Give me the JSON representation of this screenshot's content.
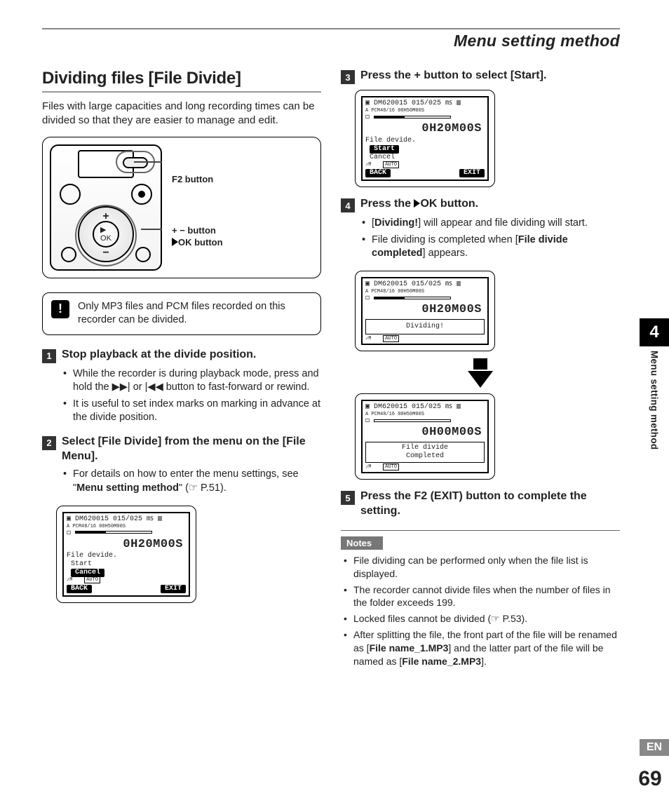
{
  "header": {
    "title": "Menu setting method"
  },
  "section_title": "Dividing files [File Divide]",
  "intro": "Files with large capacities and long recording times can be divided so that they are easier to manage and edit.",
  "diagram": {
    "label_f2": "F2 button",
    "label_plusminus": "+ − button",
    "label_ok": "OK button"
  },
  "warning": "Only MP3 files and PCM files recorded on this recorder can be divided.",
  "steps": {
    "s1": {
      "num": "1",
      "title": "Stop playback at the divide position.",
      "bullets": [
        "While the recorder is during playback mode, press and hold the  ▶▶|  or  |◀◀  button to fast-forward or rewind.",
        "It is useful to set index marks on marking in advance at the divide position."
      ]
    },
    "s2": {
      "num": "2",
      "title_parts": {
        "pre": "Select [",
        "bold1": "File Divide",
        "mid": "] from the menu on the [",
        "bold2": "File Menu",
        "post": "]."
      },
      "bullets_pre": "For details on how to enter the menu settings, see \"",
      "bullets_bold": "Menu setting method",
      "bullets_post": "\" (☞ P.51)."
    },
    "s3": {
      "num": "3",
      "title_parts": {
        "pre": "Press the + button to select [",
        "bold": "Start",
        "post": "]."
      }
    },
    "s4": {
      "num": "4",
      "title_parts": {
        "pre": "Press the ",
        "bold": "OK",
        "post": " button."
      },
      "bullets": [
        {
          "pre": "[",
          "b1": "Dividing!",
          "post": "] will appear and file dividing will start."
        },
        {
          "pre": "File dividing is completed when [",
          "b1": "File divide completed",
          "post": "] appears."
        }
      ]
    },
    "s5": {
      "num": "5",
      "title_parts": {
        "pre": "Press the ",
        "bold": "F2 (EXIT)",
        "post": " button to complete the setting."
      }
    }
  },
  "lcd_common": {
    "line1": "▣ DM620015 015/025 ㎳ ▥",
    "line2": "A  PCM48/16  00H50M00S",
    "menu_label": "File devide.",
    "start": "Start",
    "cancel": "Cancel",
    "auto": "AUTO",
    "back": "BACK",
    "exit": "EXIT",
    "dividing": "Dividing!",
    "completed1": "File divide",
    "completed2": "Completed",
    "time_a": "0H20M00S",
    "time_b": "0H00M00S"
  },
  "notes": {
    "label": "Notes",
    "items": [
      {
        "text": "File dividing can be performed only when the file list is displayed."
      },
      {
        "text": "The recorder cannot divide files when the number of files in the folder exceeds 199."
      },
      {
        "text_pre": "Locked files cannot be divided (☞ P.53).",
        "bold": ""
      },
      {
        "text_pre": "After splitting the file, the front part of the file will be renamed as [",
        "b1": "File name_1.MP3",
        "mid": "] and the latter part of the file will be named as [",
        "b2": "File name_2.MP3",
        "post": "]."
      }
    ]
  },
  "sidebar": {
    "chapter": "4",
    "label": "Menu setting method",
    "lang": "EN",
    "page": "69"
  }
}
